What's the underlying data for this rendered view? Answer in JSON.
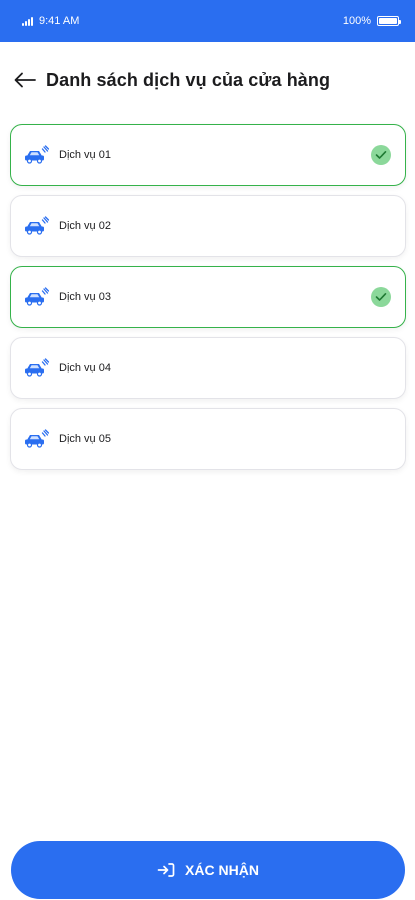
{
  "status_bar": {
    "time": "9:41 AM",
    "battery": "100%"
  },
  "header": {
    "title": "Danh sách dịch vụ của cửa hàng"
  },
  "services": [
    {
      "label": "Dịch vụ 01",
      "selected": true
    },
    {
      "label": "Dịch vụ 02",
      "selected": false
    },
    {
      "label": "Dịch vụ 03",
      "selected": true
    },
    {
      "label": "Dịch vụ 04",
      "selected": false
    },
    {
      "label": "Dịch vụ 05",
      "selected": false
    }
  ],
  "confirm_button": {
    "label": "XÁC NHẬN"
  },
  "colors": {
    "primary": "#2a6ef0",
    "selected_border": "#35b24a",
    "check_fill": "#8bd89a"
  },
  "icons": {
    "back": "arrow-left-icon",
    "service": "car-wash-icon",
    "check": "check-circle-icon",
    "confirm": "login-arrow-icon"
  }
}
